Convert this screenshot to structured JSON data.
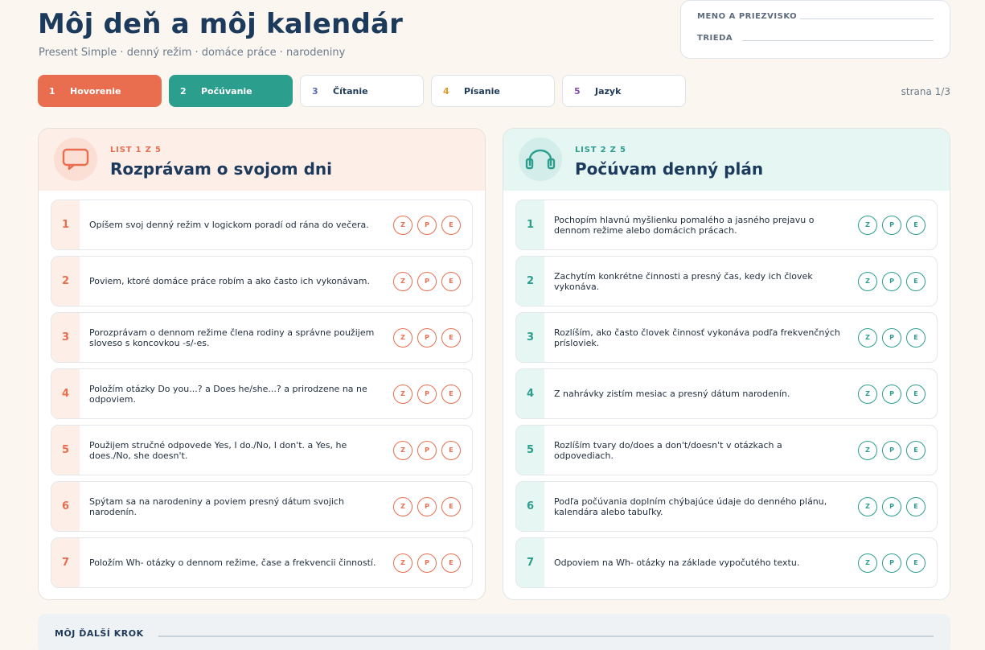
{
  "header": {
    "title": "Môj deň a môj kalendár",
    "subtitle": "Present Simple · denný režim · domáce práce · narodeniny"
  },
  "namebox": {
    "name_label": "MENO A PRIEZVISKO",
    "class_label": "TRIEDA"
  },
  "tabs": [
    {
      "num": "1",
      "label": "Hovorenie",
      "color": "#e86e4f"
    },
    {
      "num": "2",
      "label": "Počúvanie",
      "color": "#2b9e8e"
    },
    {
      "num": "3",
      "label": "Čítanie",
      "color": "#5b6bb5"
    },
    {
      "num": "4",
      "label": "Písanie",
      "color": "#e39a2a"
    },
    {
      "num": "5",
      "label": "Jazyk",
      "color": "#8a4ea8"
    }
  ],
  "page_indicator": "strana 1/3",
  "rating_labels": [
    "Z",
    "P",
    "E"
  ],
  "cards": [
    {
      "kicker": "LIST 1 Z 5",
      "heading": "Rozprávam o svojom dni",
      "icon": "speech-bubble-icon",
      "accent": "#e86e4f",
      "items": [
        {
          "num": "1",
          "text": "Opíšem svoj denný režim v logickom poradí od rána do večera."
        },
        {
          "num": "2",
          "text": "Poviem, ktoré domáce práce robím a ako často ich vykonávam."
        },
        {
          "num": "3",
          "text": "Porozprávam o dennom režime člena rodiny a správne použijem sloveso s koncovkou -s/-es."
        },
        {
          "num": "4",
          "text": "Položím otázky Do you...? a Does he/she...? a prirodzene na ne odpoviem."
        },
        {
          "num": "5",
          "text": "Použijem stručné odpovede Yes, I do./No, I don't. a Yes, he does./No, she doesn't."
        },
        {
          "num": "6",
          "text": "Spýtam sa na narodeniny a poviem presný dátum svojich narodenín."
        },
        {
          "num": "7",
          "text": "Položím Wh- otázky o dennom režime, čase a frekvencii činností."
        }
      ]
    },
    {
      "kicker": "LIST 2 Z 5",
      "heading": "Počúvam denný plán",
      "icon": "headphones-icon",
      "accent": "#2b9e8e",
      "items": [
        {
          "num": "1",
          "text": "Pochopím hlavnú myšlienku pomalého a jasného prejavu o dennom režime alebo domácich prácach."
        },
        {
          "num": "2",
          "text": "Zachytím konkrétne činnosti a presný čas, kedy ich človek vykonáva."
        },
        {
          "num": "3",
          "text": "Rozlíším, ako často človek činnosť vykonáva podľa frekvenčných prísloviek."
        },
        {
          "num": "4",
          "text": "Z nahrávky zistím mesiac a presný dátum narodenín."
        },
        {
          "num": "5",
          "text": "Rozlíším tvary do/does a don't/doesn't v otázkach a odpovediach."
        },
        {
          "num": "6",
          "text": "Podľa počúvania doplním chýbajúce údaje do denného plánu, kalendára alebo tabuľky."
        },
        {
          "num": "7",
          "text": "Odpoviem na Wh- otázky na základe vypočutého textu."
        }
      ]
    }
  ],
  "footer": {
    "label": "MÔJ ĎALŠÍ KROK"
  }
}
